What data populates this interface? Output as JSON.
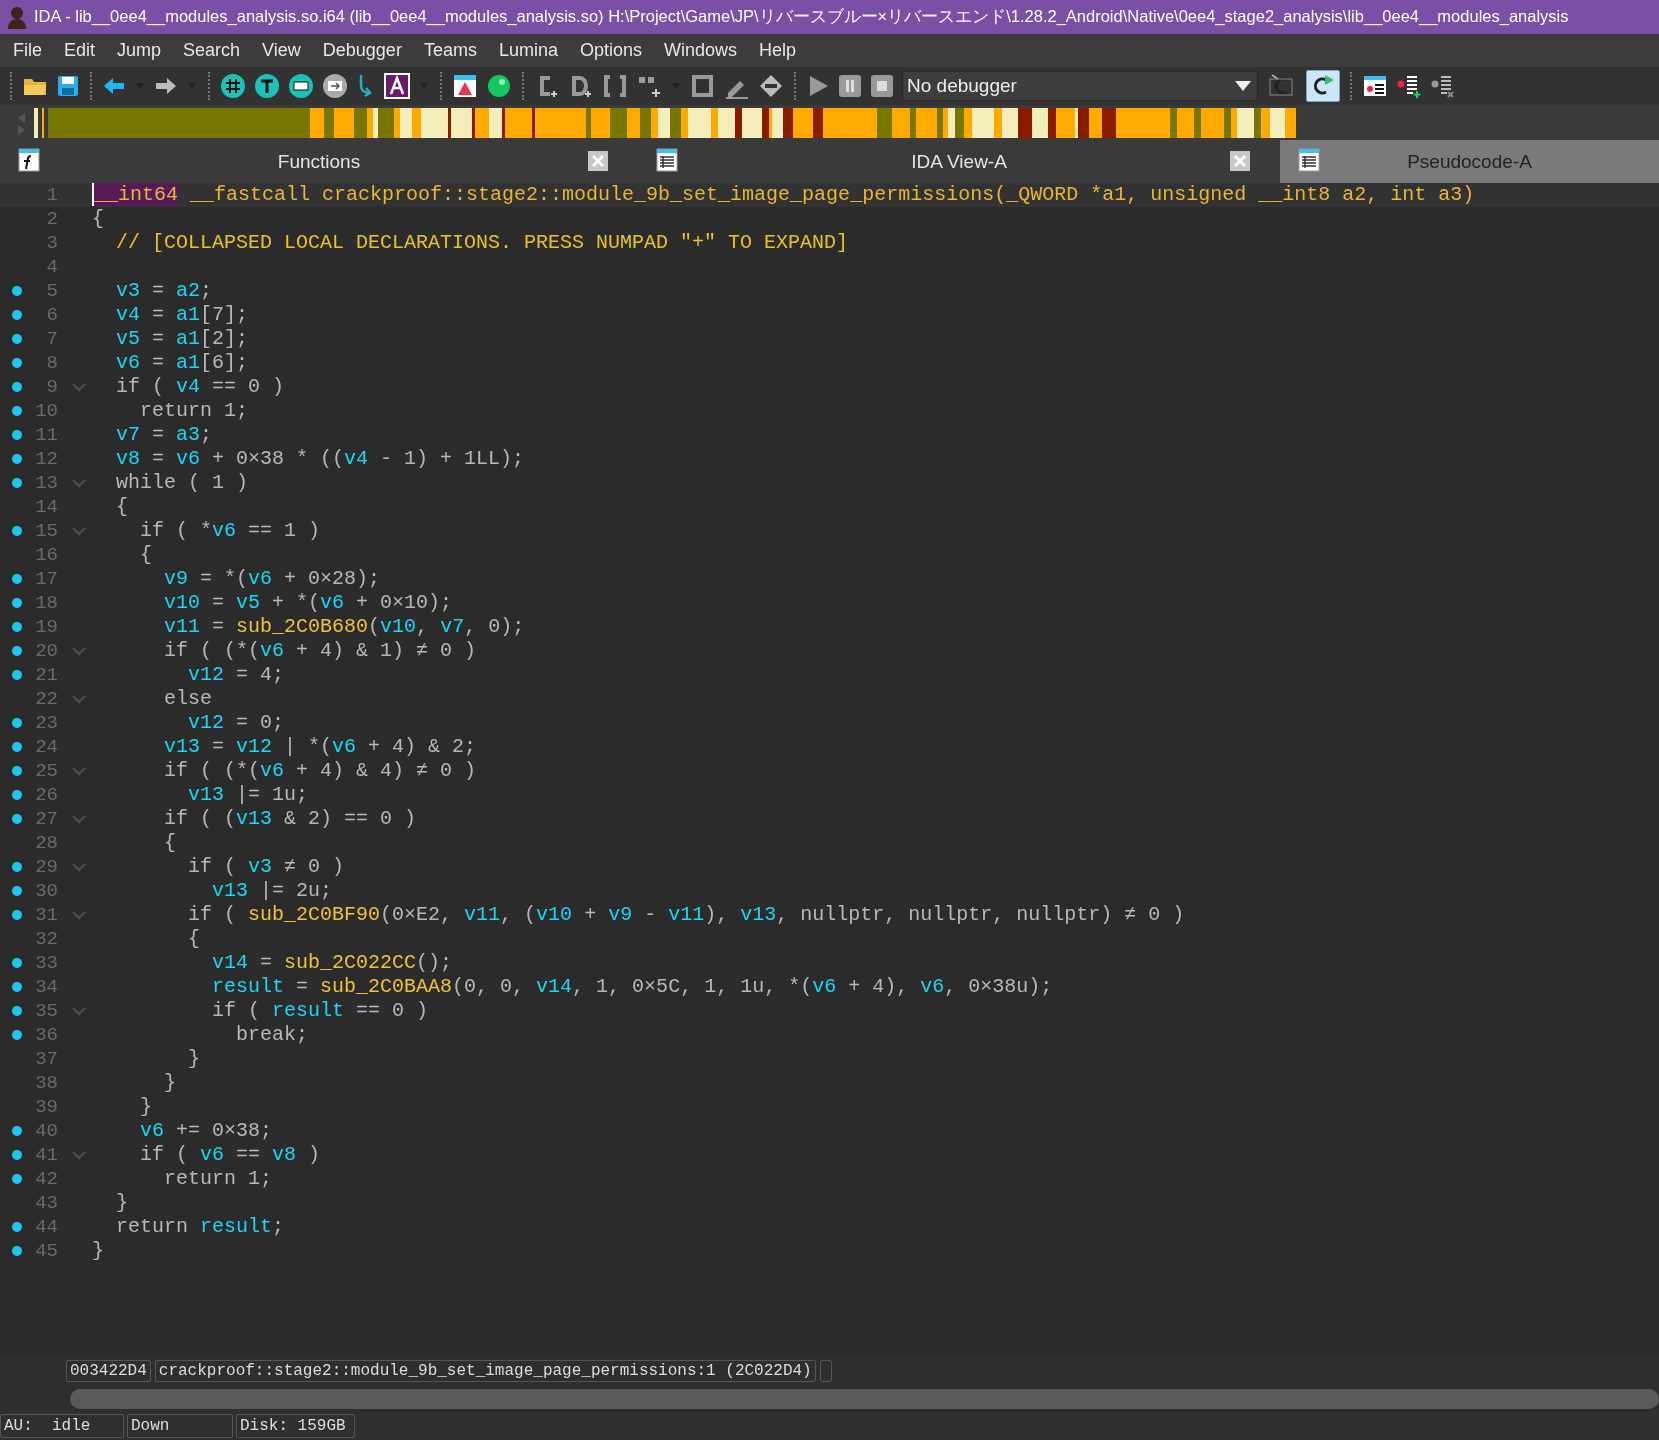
{
  "window": {
    "title": "IDA - lib__0ee4__modules_analysis.so.i64 (lib__0ee4__modules_analysis.so) H:\\Project\\Game\\JP\\リバースブルー×リバースエンド\\1.28.2_Android\\Native\\0ee4_stage2_analysis\\lib__0ee4__modules_analysis"
  },
  "menu": [
    "File",
    "Edit",
    "Jump",
    "Search",
    "View",
    "Debugger",
    "Teams",
    "Lumina",
    "Options",
    "Windows",
    "Help"
  ],
  "toolbar": {
    "debugger_select": "No debugger",
    "buttons": [
      {
        "kind": "decompile",
        "pressed": false
      },
      {
        "kind": "decompile-run",
        "pressed": true
      }
    ]
  },
  "tabs": [
    {
      "label": "Functions",
      "kind": "functions",
      "selected": false,
      "closable": true
    },
    {
      "label": "IDA View-A",
      "kind": "listing",
      "selected": false,
      "closable": true
    },
    {
      "label": "Pseudocode-A",
      "kind": "listing",
      "selected": true,
      "closable": false
    }
  ],
  "code": [
    {
      "number": "1",
      "dot": false,
      "foldable": false,
      "tokens": [
        {
          "kind": "hl",
          "text": "__int64"
        },
        {
          "kind": "decl",
          "text": " __fastcall crackproof::stage2::module_9b_set_image_page_permissions(_QWORD *a1, unsigned __int8 a2, int a3)"
        }
      ]
    },
    {
      "number": "2",
      "dot": false,
      "foldable": false,
      "tokens": [
        {
          "kind": "code",
          "text": "{"
        }
      ]
    },
    {
      "number": "3",
      "dot": false,
      "foldable": false,
      "tokens": [
        {
          "kind": "comment",
          "text": "  // [COLLAPSED LOCAL DECLARATIONS. PRESS NUMPAD \"+\" TO EXPAND]"
        }
      ]
    },
    {
      "number": "4",
      "dot": false,
      "foldable": false
    },
    {
      "number": "5",
      "dot": true,
      "foldable": false,
      "tokens": [
        {
          "kind": "var",
          "text": "  v3"
        },
        {
          "kind": "code",
          "text": " = "
        },
        {
          "kind": "var",
          "text": "a2"
        },
        {
          "kind": "code",
          "text": ";"
        }
      ]
    },
    {
      "number": "6",
      "dot": true,
      "foldable": false,
      "tokens": [
        {
          "kind": "var",
          "text": "  v4"
        },
        {
          "kind": "code",
          "text": " = "
        },
        {
          "kind": "var",
          "text": "a1"
        },
        {
          "kind": "code",
          "text": "[7];"
        }
      ]
    },
    {
      "number": "7",
      "dot": true,
      "foldable": false,
      "tokens": [
        {
          "kind": "var",
          "text": "  v5"
        },
        {
          "kind": "code",
          "text": " = "
        },
        {
          "kind": "var",
          "text": "a1"
        },
        {
          "kind": "code",
          "text": "[2];"
        }
      ]
    },
    {
      "number": "8",
      "dot": true,
      "foldable": false,
      "tokens": [
        {
          "kind": "var",
          "text": "  v6"
        },
        {
          "kind": "code",
          "text": " = "
        },
        {
          "kind": "var",
          "text": "a1"
        },
        {
          "kind": "code",
          "text": "[6];"
        }
      ]
    },
    {
      "number": "9",
      "dot": true,
      "foldable": true,
      "tokens": [
        {
          "kind": "code",
          "text": "  if ( "
        },
        {
          "kind": "var",
          "text": "v4"
        },
        {
          "kind": "code",
          "text": " == 0 )"
        }
      ]
    },
    {
      "number": "10",
      "dot": true,
      "foldable": false,
      "tokens": [
        {
          "kind": "code",
          "text": "    return 1;"
        }
      ]
    },
    {
      "number": "11",
      "dot": true,
      "foldable": false,
      "tokens": [
        {
          "kind": "var",
          "text": "  v7"
        },
        {
          "kind": "code",
          "text": " = "
        },
        {
          "kind": "var",
          "text": "a3"
        },
        {
          "kind": "code",
          "text": ";"
        }
      ]
    },
    {
      "number": "12",
      "dot": true,
      "foldable": false,
      "tokens": [
        {
          "kind": "var",
          "text": "  v8"
        },
        {
          "kind": "code",
          "text": " = "
        },
        {
          "kind": "var",
          "text": "v6"
        },
        {
          "kind": "code",
          "text": " + 0×38 * (("
        },
        {
          "kind": "var",
          "text": "v4"
        },
        {
          "kind": "code",
          "text": " - 1) + 1LL);"
        }
      ]
    },
    {
      "number": "13",
      "dot": true,
      "foldable": true,
      "tokens": [
        {
          "kind": "code",
          "text": "  while ( 1 )"
        }
      ]
    },
    {
      "number": "14",
      "dot": false,
      "foldable": false,
      "tokens": [
        {
          "kind": "code",
          "text": "  {"
        }
      ]
    },
    {
      "number": "15",
      "dot": true,
      "foldable": true,
      "tokens": [
        {
          "kind": "code",
          "text": "    if ( *"
        },
        {
          "kind": "var",
          "text": "v6"
        },
        {
          "kind": "code",
          "text": " == 1 )"
        }
      ]
    },
    {
      "number": "16",
      "dot": false,
      "foldable": false,
      "tokens": [
        {
          "kind": "code",
          "text": "    {"
        }
      ]
    },
    {
      "number": "17",
      "dot": true,
      "foldable": false,
      "tokens": [
        {
          "kind": "var",
          "text": "      v9"
        },
        {
          "kind": "code",
          "text": " = *("
        },
        {
          "kind": "var",
          "text": "v6"
        },
        {
          "kind": "code",
          "text": " + 0×28);"
        }
      ]
    },
    {
      "number": "18",
      "dot": true,
      "foldable": false,
      "tokens": [
        {
          "kind": "var",
          "text": "      v10"
        },
        {
          "kind": "code",
          "text": " = "
        },
        {
          "kind": "var",
          "text": "v5"
        },
        {
          "kind": "code",
          "text": " + *("
        },
        {
          "kind": "var",
          "text": "v6"
        },
        {
          "kind": "code",
          "text": " + 0×10);"
        }
      ]
    },
    {
      "number": "19",
      "dot": true,
      "foldable": false,
      "tokens": [
        {
          "kind": "var",
          "text": "      v11"
        },
        {
          "kind": "code",
          "text": " = "
        },
        {
          "kind": "call",
          "text": "sub_2C0B680"
        },
        {
          "kind": "code",
          "text": "("
        },
        {
          "kind": "var",
          "text": "v10"
        },
        {
          "kind": "code",
          "text": ", "
        },
        {
          "kind": "var",
          "text": "v7"
        },
        {
          "kind": "code",
          "text": ", 0);"
        }
      ]
    },
    {
      "number": "20",
      "dot": true,
      "foldable": true,
      "tokens": [
        {
          "kind": "code",
          "text": "      if ( (*("
        },
        {
          "kind": "var",
          "text": "v6"
        },
        {
          "kind": "code",
          "text": " + 4) & 1) ≠ 0 )"
        }
      ]
    },
    {
      "number": "21",
      "dot": true,
      "foldable": false,
      "tokens": [
        {
          "kind": "var",
          "text": "        v12"
        },
        {
          "kind": "code",
          "text": " = 4;"
        }
      ]
    },
    {
      "number": "22",
      "dot": false,
      "foldable": true,
      "tokens": [
        {
          "kind": "code",
          "text": "      else"
        }
      ]
    },
    {
      "number": "23",
      "dot": true,
      "foldable": false,
      "tokens": [
        {
          "kind": "var",
          "text": "        v12"
        },
        {
          "kind": "code",
          "text": " = 0;"
        }
      ]
    },
    {
      "number": "24",
      "dot": true,
      "foldable": false,
      "tokens": [
        {
          "kind": "var",
          "text": "      v13"
        },
        {
          "kind": "code",
          "text": " = "
        },
        {
          "kind": "var",
          "text": "v12"
        },
        {
          "kind": "code",
          "text": " | *("
        },
        {
          "kind": "var",
          "text": "v6"
        },
        {
          "kind": "code",
          "text": " + 4) & 2;"
        }
      ]
    },
    {
      "number": "25",
      "dot": true,
      "foldable": true,
      "tokens": [
        {
          "kind": "code",
          "text": "      if ( (*("
        },
        {
          "kind": "var",
          "text": "v6"
        },
        {
          "kind": "code",
          "text": " + 4) & 4) ≠ 0 )"
        }
      ]
    },
    {
      "number": "26",
      "dot": true,
      "foldable": false,
      "tokens": [
        {
          "kind": "var",
          "text": "        v13"
        },
        {
          "kind": "code",
          "text": " |= 1u;"
        }
      ]
    },
    {
      "number": "27",
      "dot": true,
      "foldable": true,
      "tokens": [
        {
          "kind": "code",
          "text": "      if ( ("
        },
        {
          "kind": "var",
          "text": "v13"
        },
        {
          "kind": "code",
          "text": " & 2) == 0 )"
        }
      ]
    },
    {
      "number": "28",
      "dot": false,
      "foldable": false,
      "tokens": [
        {
          "kind": "code",
          "text": "      {"
        }
      ]
    },
    {
      "number": "29",
      "dot": true,
      "foldable": true,
      "tokens": [
        {
          "kind": "code",
          "text": "        if ( "
        },
        {
          "kind": "var",
          "text": "v3"
        },
        {
          "kind": "code",
          "text": " ≠ 0 )"
        }
      ]
    },
    {
      "number": "30",
      "dot": true,
      "foldable": false,
      "tokens": [
        {
          "kind": "var",
          "text": "          v13"
        },
        {
          "kind": "code",
          "text": " |= 2u;"
        }
      ]
    },
    {
      "number": "31",
      "dot": true,
      "foldable": true,
      "tokens": [
        {
          "kind": "code",
          "text": "        if ( "
        },
        {
          "kind": "call",
          "text": "sub_2C0BF90"
        },
        {
          "kind": "code",
          "text": "(0×E2, "
        },
        {
          "kind": "var",
          "text": "v11"
        },
        {
          "kind": "code",
          "text": ", ("
        },
        {
          "kind": "var",
          "text": "v10"
        },
        {
          "kind": "code",
          "text": " + "
        },
        {
          "kind": "var",
          "text": "v9"
        },
        {
          "kind": "code",
          "text": " - "
        },
        {
          "kind": "var",
          "text": "v11"
        },
        {
          "kind": "code",
          "text": "), "
        },
        {
          "kind": "var",
          "text": "v13"
        },
        {
          "kind": "code",
          "text": ", nullptr, nullptr, nullptr) ≠ 0 )"
        }
      ]
    },
    {
      "number": "32",
      "dot": false,
      "foldable": false,
      "tokens": [
        {
          "kind": "code",
          "text": "        {"
        }
      ]
    },
    {
      "number": "33",
      "dot": true,
      "foldable": false,
      "tokens": [
        {
          "kind": "var",
          "text": "          v14"
        },
        {
          "kind": "code",
          "text": " = "
        },
        {
          "kind": "call",
          "text": "sub_2C022CC"
        },
        {
          "kind": "code",
          "text": "();"
        }
      ]
    },
    {
      "number": "34",
      "dot": true,
      "foldable": false,
      "tokens": [
        {
          "kind": "var",
          "text": "          result"
        },
        {
          "kind": "code",
          "text": " = "
        },
        {
          "kind": "call",
          "text": "sub_2C0BAA8"
        },
        {
          "kind": "code",
          "text": "(0, 0, "
        },
        {
          "kind": "var",
          "text": "v14"
        },
        {
          "kind": "code",
          "text": ", 1, 0×5C, 1, 1u, *("
        },
        {
          "kind": "var",
          "text": "v6"
        },
        {
          "kind": "code",
          "text": " + 4), "
        },
        {
          "kind": "var",
          "text": "v6"
        },
        {
          "kind": "code",
          "text": ", 0×38u);"
        }
      ]
    },
    {
      "number": "35",
      "dot": true,
      "foldable": true,
      "tokens": [
        {
          "kind": "code",
          "text": "          if ( "
        },
        {
          "kind": "var",
          "text": "result"
        },
        {
          "kind": "code",
          "text": " == 0 )"
        }
      ]
    },
    {
      "number": "36",
      "dot": true,
      "foldable": false,
      "tokens": [
        {
          "kind": "code",
          "text": "            break;"
        }
      ]
    },
    {
      "number": "37",
      "dot": false,
      "foldable": false,
      "tokens": [
        {
          "kind": "code",
          "text": "        }"
        }
      ]
    },
    {
      "number": "38",
      "dot": false,
      "foldable": false,
      "tokens": [
        {
          "kind": "code",
          "text": "      }"
        }
      ]
    },
    {
      "number": "39",
      "dot": false,
      "foldable": false,
      "tokens": [
        {
          "kind": "code",
          "text": "    }"
        }
      ]
    },
    {
      "number": "40",
      "dot": true,
      "foldable": false,
      "tokens": [
        {
          "kind": "var",
          "text": "    v6"
        },
        {
          "kind": "code",
          "text": " += 0×38;"
        }
      ]
    },
    {
      "number": "41",
      "dot": true,
      "foldable": true,
      "tokens": [
        {
          "kind": "code",
          "text": "    if ( "
        },
        {
          "kind": "var",
          "text": "v6"
        },
        {
          "kind": "code",
          "text": " == "
        },
        {
          "kind": "var",
          "text": "v8"
        },
        {
          "kind": "code",
          "text": " )"
        }
      ]
    },
    {
      "number": "42",
      "dot": true,
      "foldable": false,
      "tokens": [
        {
          "kind": "code",
          "text": "      return 1;"
        }
      ]
    },
    {
      "number": "43",
      "dot": false,
      "foldable": false,
      "tokens": [
        {
          "kind": "code",
          "text": "  }"
        }
      ]
    },
    {
      "number": "44",
      "dot": true,
      "foldable": false,
      "tokens": [
        {
          "kind": "code",
          "text": "  return "
        },
        {
          "kind": "var",
          "text": "result"
        },
        {
          "kind": "code",
          "text": ";"
        }
      ]
    },
    {
      "number": "45",
      "dot": true,
      "foldable": false,
      "tokens": [
        {
          "kind": "code",
          "text": "}"
        }
      ]
    }
  ],
  "location_bar": {
    "address": "003422D4",
    "function": "crackproof::stage2::module_9b_set_image_page_permissions:1 (2C022D4)"
  },
  "status_bar": [
    "AU:  idle",
    "Down",
    "Disk: 159GB"
  ]
}
